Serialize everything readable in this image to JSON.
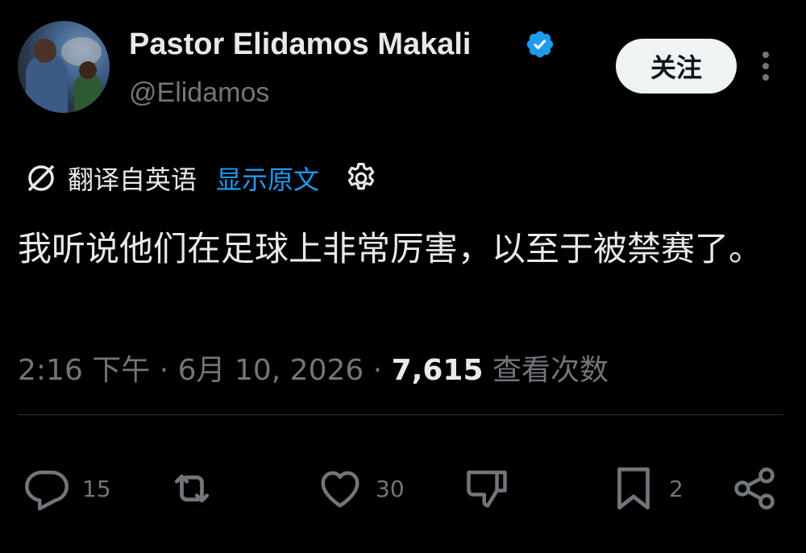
{
  "user": {
    "display_name": "Pastor Elidamos Makali",
    "handle": "@Elidamos",
    "verified_icon": "verified-badge-icon",
    "accent_color": "#1d9bf0"
  },
  "follow_label": "关注",
  "translation": {
    "label": "翻译自英语",
    "link": "显示原文"
  },
  "tweet": {
    "text": "我听说他们在足球上非常厉害，以至于被禁赛了。"
  },
  "meta": {
    "time": "2:16 下午",
    "separator1": " · ",
    "date": "6月 10, 2026",
    "separator2": " · ",
    "views": "7,615",
    "views_label": " 查看次数"
  },
  "actions": {
    "replies": "15",
    "likes": "30",
    "bookmarks": "2"
  }
}
